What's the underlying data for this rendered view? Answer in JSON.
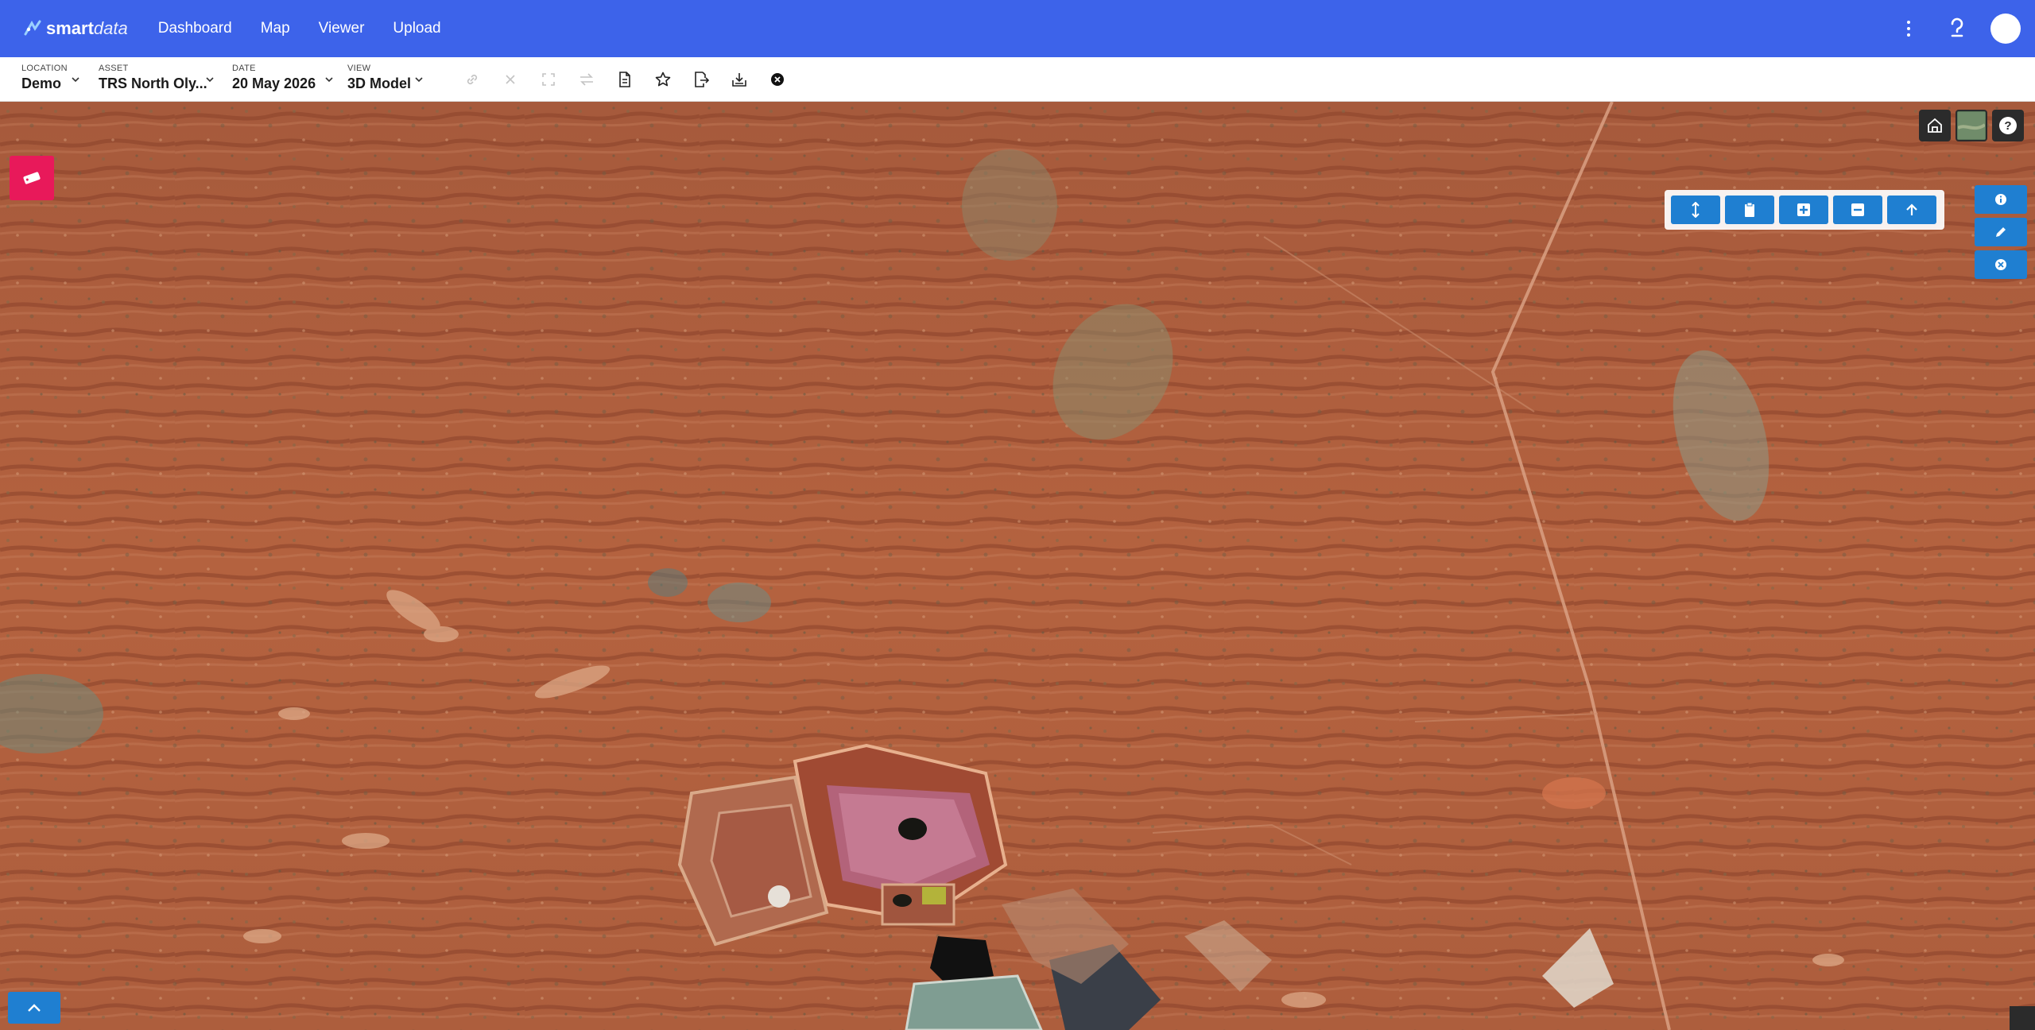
{
  "brand": {
    "smart": "smart",
    "data": "data",
    "color": "#3d63ea"
  },
  "nav": {
    "links": [
      {
        "label": "Dashboard"
      },
      {
        "label": "Map"
      },
      {
        "label": "Viewer"
      },
      {
        "label": "Upload"
      }
    ],
    "icons": [
      "more-vert-icon",
      "help-icon",
      "avatar"
    ]
  },
  "toolbar": {
    "location": {
      "label": "LOCATION",
      "value": "Demo"
    },
    "asset": {
      "label": "ASSET",
      "value": "TRS North Oly..."
    },
    "date": {
      "label": "DATE",
      "value": "20 May 2026"
    },
    "view": {
      "label": "VIEW",
      "value": "3D Model"
    },
    "icons": [
      {
        "name": "link-icon",
        "disabled": true
      },
      {
        "name": "close-icon",
        "disabled": true
      },
      {
        "name": "fullscreen-icon",
        "disabled": true
      },
      {
        "name": "swap-icon",
        "disabled": true
      },
      {
        "name": "document-icon",
        "disabled": false
      },
      {
        "name": "star-icon",
        "disabled": false
      },
      {
        "name": "export-icon",
        "disabled": false
      },
      {
        "name": "download-icon",
        "disabled": false
      },
      {
        "name": "close-circle-icon",
        "disabled": false
      }
    ]
  },
  "map": {
    "badge": {
      "icon": "tag-icon",
      "color": "#e8195a"
    },
    "top_right": [
      "home-icon",
      "layer-thumbnail",
      "help-icon"
    ],
    "measure_tools": [
      "height-icon",
      "clipboard-icon",
      "add-box-icon",
      "minus-box-icon",
      "arrow-up-icon"
    ],
    "side_tools": [
      "info-icon",
      "pencil-icon",
      "close-circle-icon"
    ],
    "expand": "chevron-up-icon",
    "accent": "#1f7fd1"
  }
}
